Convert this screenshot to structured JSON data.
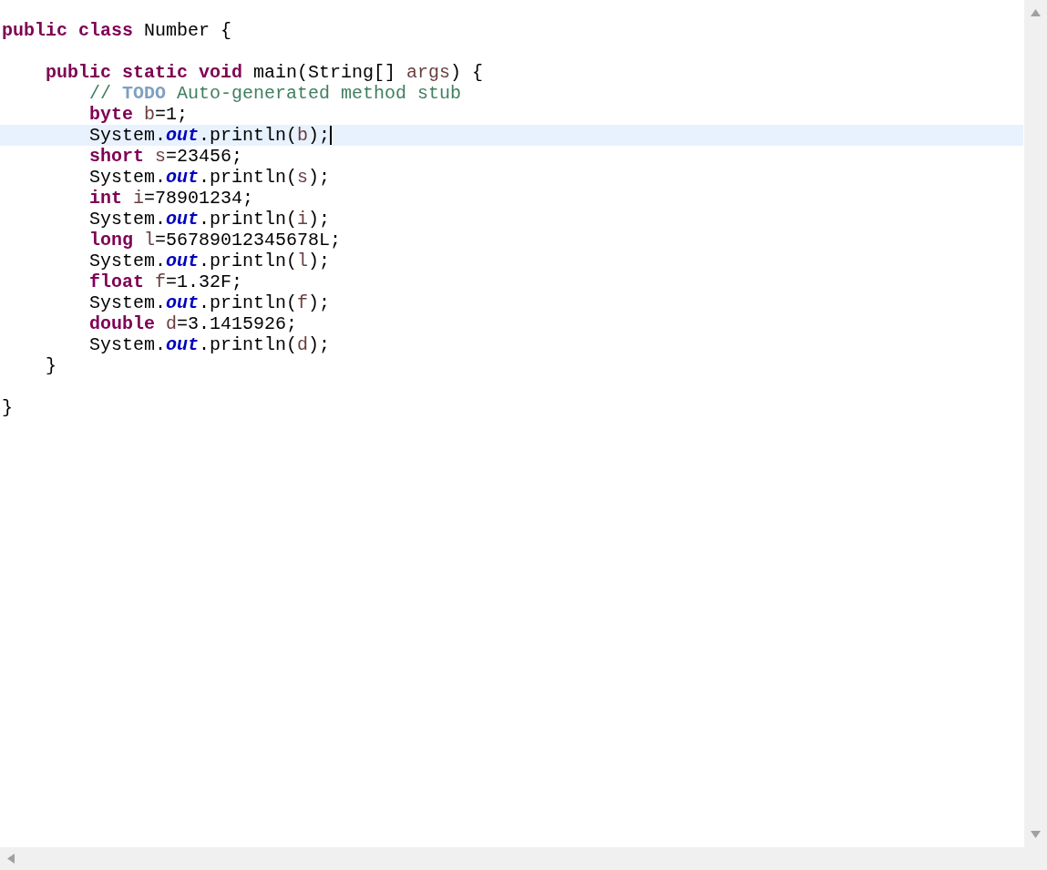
{
  "editor": {
    "lines": [
      {
        "current": false,
        "tokens": [
          {
            "kind": "keyword",
            "text": "public class"
          },
          {
            "kind": "plain",
            "text": " Number {"
          }
        ]
      },
      {
        "current": false
      },
      {
        "current": false,
        "tokens": [
          {
            "kind": "keyword",
            "text": "    public static void"
          },
          {
            "kind": "plain",
            "text": " main(String[] "
          },
          {
            "kind": "variable",
            "text": "args"
          },
          {
            "kind": "plain",
            "text": ") {"
          }
        ]
      },
      {
        "current": false,
        "tokens": [
          {
            "kind": "comment",
            "text": "        // "
          },
          {
            "kind": "todo",
            "text": "TODO"
          },
          {
            "kind": "comment",
            "text": " Auto-generated method stub"
          }
        ]
      },
      {
        "current": false,
        "tokens": [
          {
            "kind": "keyword",
            "text": "        byte "
          },
          {
            "kind": "variable",
            "text": "b"
          },
          {
            "kind": "plain",
            "text": "=1;"
          }
        ]
      },
      {
        "current": true,
        "tokens": [
          {
            "kind": "plain",
            "text": "        System."
          },
          {
            "kind": "field",
            "text": "out"
          },
          {
            "kind": "plain",
            "text": ".println("
          },
          {
            "kind": "variable",
            "text": "b"
          },
          {
            "kind": "plain",
            "text": ");"
          }
        ]
      },
      {
        "current": false,
        "tokens": [
          {
            "kind": "keyword",
            "text": "        short "
          },
          {
            "kind": "variable",
            "text": "s"
          },
          {
            "kind": "plain",
            "text": "=23456;"
          }
        ]
      },
      {
        "current": false,
        "tokens": [
          {
            "kind": "plain",
            "text": "        System."
          },
          {
            "kind": "field",
            "text": "out"
          },
          {
            "kind": "plain",
            "text": ".println("
          },
          {
            "kind": "variable",
            "text": "s"
          },
          {
            "kind": "plain",
            "text": ");"
          }
        ]
      },
      {
        "current": false,
        "tokens": [
          {
            "kind": "keyword",
            "text": "        int "
          },
          {
            "kind": "variable",
            "text": "i"
          },
          {
            "kind": "plain",
            "text": "=78901234;"
          }
        ]
      },
      {
        "current": false,
        "tokens": [
          {
            "kind": "plain",
            "text": "        System."
          },
          {
            "kind": "field",
            "text": "out"
          },
          {
            "kind": "plain",
            "text": ".println("
          },
          {
            "kind": "variable",
            "text": "i"
          },
          {
            "kind": "plain",
            "text": ");"
          }
        ]
      },
      {
        "current": false,
        "tokens": [
          {
            "kind": "keyword",
            "text": "        long "
          },
          {
            "kind": "variable",
            "text": "l"
          },
          {
            "kind": "plain",
            "text": "=56789012345678L;"
          }
        ]
      },
      {
        "current": false,
        "tokens": [
          {
            "kind": "plain",
            "text": "        System."
          },
          {
            "kind": "field",
            "text": "out"
          },
          {
            "kind": "plain",
            "text": ".println("
          },
          {
            "kind": "variable",
            "text": "l"
          },
          {
            "kind": "plain",
            "text": ");"
          }
        ]
      },
      {
        "current": false,
        "tokens": [
          {
            "kind": "keyword",
            "text": "        float "
          },
          {
            "kind": "variable",
            "text": "f"
          },
          {
            "kind": "plain",
            "text": "=1.32F;"
          }
        ]
      },
      {
        "current": false,
        "tokens": [
          {
            "kind": "plain",
            "text": "        System."
          },
          {
            "kind": "field",
            "text": "out"
          },
          {
            "kind": "plain",
            "text": ".println("
          },
          {
            "kind": "variable",
            "text": "f"
          },
          {
            "kind": "plain",
            "text": ");"
          }
        ]
      },
      {
        "current": false,
        "tokens": [
          {
            "kind": "keyword",
            "text": "        double "
          },
          {
            "kind": "variable",
            "text": "d"
          },
          {
            "kind": "plain",
            "text": "=3.1415926;"
          }
        ]
      },
      {
        "current": false,
        "tokens": [
          {
            "kind": "plain",
            "text": "        System."
          },
          {
            "kind": "field",
            "text": "out"
          },
          {
            "kind": "plain",
            "text": ".println("
          },
          {
            "kind": "variable",
            "text": "d"
          },
          {
            "kind": "plain",
            "text": ");"
          }
        ]
      },
      {
        "current": false,
        "tokens": [
          {
            "kind": "plain",
            "text": "    }"
          }
        ]
      },
      {
        "current": false
      },
      {
        "current": false,
        "tokens": [
          {
            "kind": "plain",
            "text": "}"
          }
        ]
      }
    ]
  }
}
